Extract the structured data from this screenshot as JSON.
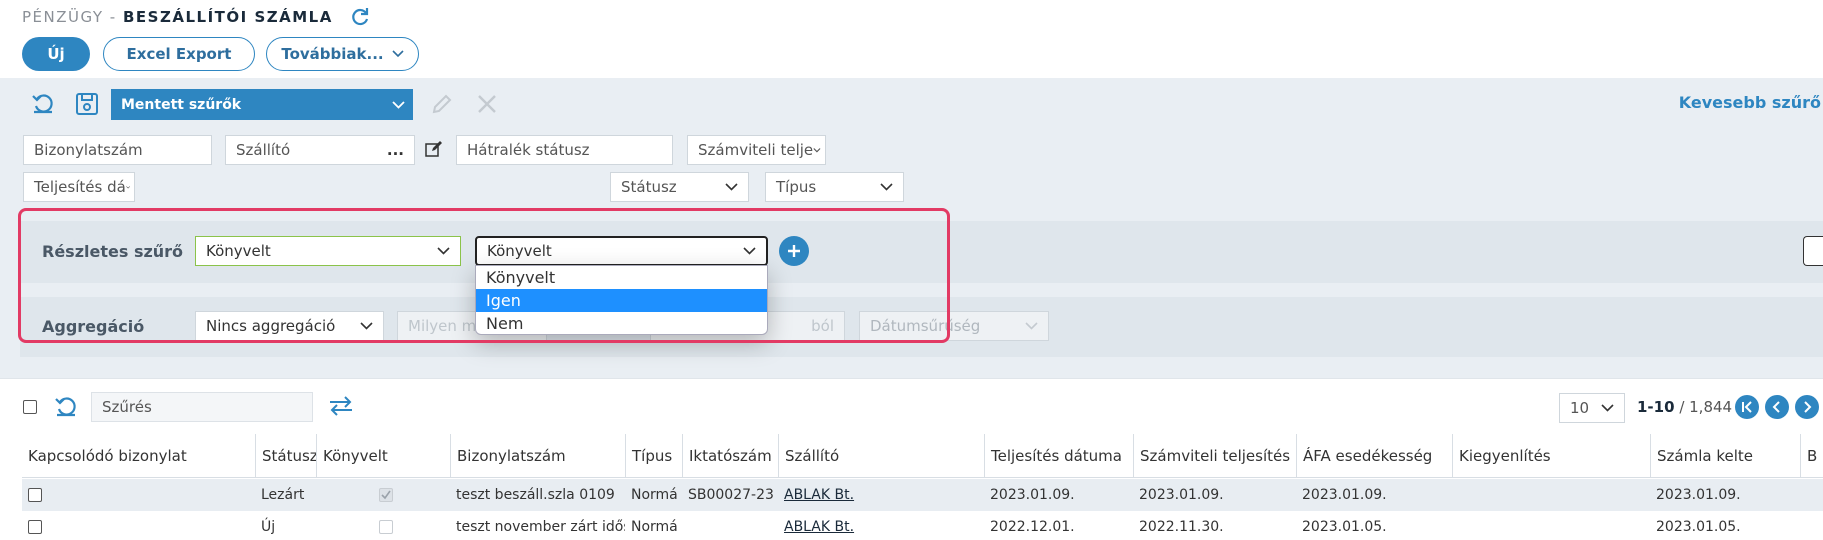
{
  "header": {
    "module": "PÉNZÜGY - ",
    "page_title": "BESZÁLLÍTÓI SZÁMLA"
  },
  "actions": {
    "new": "Új",
    "excel_export": "Excel Export",
    "more": "Továbbiak..."
  },
  "filter_toolbar": {
    "saved_filters": "Mentett szűrők",
    "less_filters": "Kevesebb szűrő"
  },
  "filters": {
    "document_number": "Bizonylatszám",
    "supplier": "Szállító",
    "supplier_more": "...",
    "overdue_status": "Hátralék státusz",
    "accounting_fulfillment": "Számviteli telje",
    "fulfillment_date": "Teljesítés dá",
    "status": "Státusz",
    "type": "Típus"
  },
  "detail_filter": {
    "label": "Részletes szűrő",
    "field": "Könyvelt",
    "value": "Könyvelt",
    "options": [
      "Könyvelt",
      "Igen",
      "Nem"
    ],
    "selected_index": 1
  },
  "aggregation": {
    "label": "Aggregáció",
    "value": "Nincs aggregáció",
    "placeholder_1": "Milyen m",
    "placeholder_2": "ból",
    "date_granularity": "Dátumsűrűség"
  },
  "list_toolbar": {
    "search_placeholder": "Szűrés",
    "page_size": "10",
    "range": "1-10",
    "total": " / 1,844"
  },
  "table": {
    "columns": [
      "Kapcsolódó bizonylat",
      "Státusz",
      "Könyvelt",
      "Bizonylatszám",
      "Típus",
      "Iktatószám",
      "Szállító",
      "Teljesítés dátuma",
      "Számviteli teljesítés",
      "ÁFA esedékesség",
      "Kiegyenlítés",
      "Számla kelte",
      "B"
    ],
    "rows": [
      [
        "",
        "Lezárt",
        "",
        "teszt beszáll.szla 0109",
        "Normá",
        "SB00027-23",
        "ABLAK Bt.",
        "2023.01.09.",
        "2023.01.09.",
        "2023.01.09.",
        "",
        "2023.01.09.",
        ""
      ],
      [
        "",
        "Új",
        "",
        "teszt november zárt idős",
        "Normá",
        "",
        "ABLAK Bt.",
        "2022.12.01.",
        "2022.11.30.",
        "2023.01.05.",
        "",
        "2023.01.05.",
        ""
      ]
    ]
  },
  "colors": {
    "accent": "#2e86c1",
    "highlight": "#e23a64",
    "selected_option": "#1e90ff"
  }
}
